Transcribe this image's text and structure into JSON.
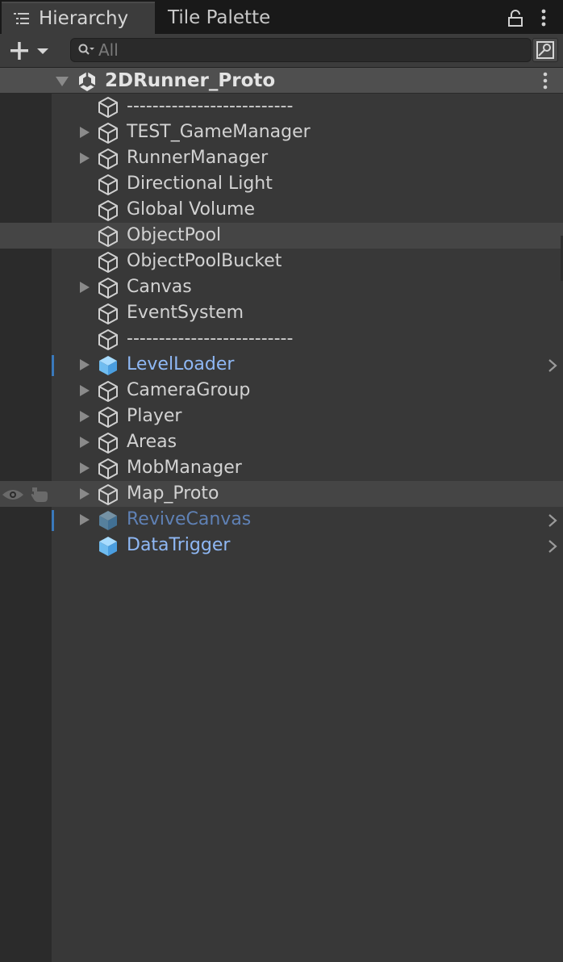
{
  "tabs": [
    {
      "label": "Hierarchy",
      "icon": "hierarchy-list-icon",
      "active": true
    },
    {
      "label": "Tile Palette",
      "active": false
    }
  ],
  "toolbar": {
    "add_icon": "plus-icon",
    "search_placeholder": "All",
    "search_icon": "search-icon",
    "search_mode_icon": "search-in-scene-icon"
  },
  "scene": {
    "name": "2DRunner_Proto",
    "icon": "unity-logo-icon",
    "expanded": true
  },
  "items": [
    {
      "label": "--------------------------",
      "foldout": false,
      "prefab": "none"
    },
    {
      "label": "TEST_GameManager",
      "foldout": true,
      "prefab": "none"
    },
    {
      "label": "RunnerManager",
      "foldout": true,
      "prefab": "none"
    },
    {
      "label": "Directional Light",
      "foldout": false,
      "prefab": "none"
    },
    {
      "label": "Global Volume",
      "foldout": false,
      "prefab": "none"
    },
    {
      "label": "ObjectPool",
      "foldout": false,
      "prefab": "none",
      "highlighted": true
    },
    {
      "label": "ObjectPoolBucket",
      "foldout": false,
      "prefab": "none"
    },
    {
      "label": "Canvas",
      "foldout": true,
      "prefab": "none"
    },
    {
      "label": "EventSystem",
      "foldout": false,
      "prefab": "none"
    },
    {
      "label": "--------------------------",
      "foldout": false,
      "prefab": "none"
    },
    {
      "label": "LevelLoader",
      "foldout": true,
      "prefab": "active",
      "override_mark": true,
      "chevron": true
    },
    {
      "label": "CameraGroup",
      "foldout": true,
      "prefab": "none"
    },
    {
      "label": "Player",
      "foldout": true,
      "prefab": "none"
    },
    {
      "label": "Areas",
      "foldout": true,
      "prefab": "none"
    },
    {
      "label": "MobManager",
      "foldout": true,
      "prefab": "none"
    },
    {
      "label": "Map_Proto",
      "foldout": true,
      "prefab": "none",
      "highlighted": true,
      "visibility_icon": "eye-icon",
      "pickable_icon": "hand-pointer-icon"
    },
    {
      "label": "ReviveCanvas",
      "foldout": true,
      "prefab": "inactive",
      "override_mark": true,
      "chevron": true
    },
    {
      "label": "DataTrigger",
      "foldout": false,
      "prefab": "active",
      "chevron": true
    }
  ],
  "colors": {
    "background": "#383838",
    "gutter": "#2b2b2b",
    "scene_header": "#4f4f4f",
    "row_highlight": "#454545",
    "text": "#d2d2d2",
    "prefab_text": "#8fb8f5",
    "prefab_inactive_text": "#5f81b5",
    "prefab_cube": "#6fbcf0",
    "override_mark": "#3a79bb"
  }
}
